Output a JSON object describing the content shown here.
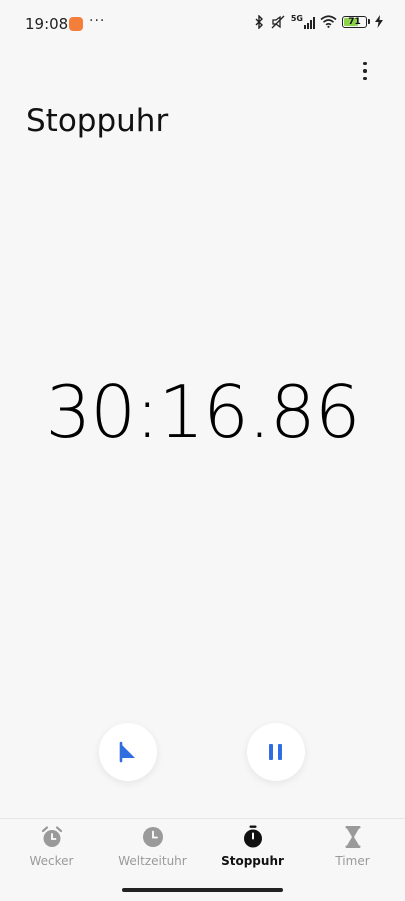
{
  "status_bar": {
    "time": "19:08",
    "dots": "···",
    "network": "5G",
    "battery": "71",
    "battery_level_percent": 71
  },
  "header": {
    "title": "Stoppuhr"
  },
  "stopwatch": {
    "display": "30:16.86"
  },
  "controls": {
    "lap_icon": "flag-icon",
    "pause_icon": "pause-icon",
    "accent_color": "#2f6ee0"
  },
  "bottom_nav": {
    "items": [
      {
        "label": "Wecker",
        "icon": "alarm-clock-icon",
        "active": false
      },
      {
        "label": "Weltzeituhr",
        "icon": "clock-icon",
        "active": false
      },
      {
        "label": "Stoppuhr",
        "icon": "stopwatch-icon",
        "active": true
      },
      {
        "label": "Timer",
        "icon": "hourglass-icon",
        "active": false
      }
    ]
  }
}
